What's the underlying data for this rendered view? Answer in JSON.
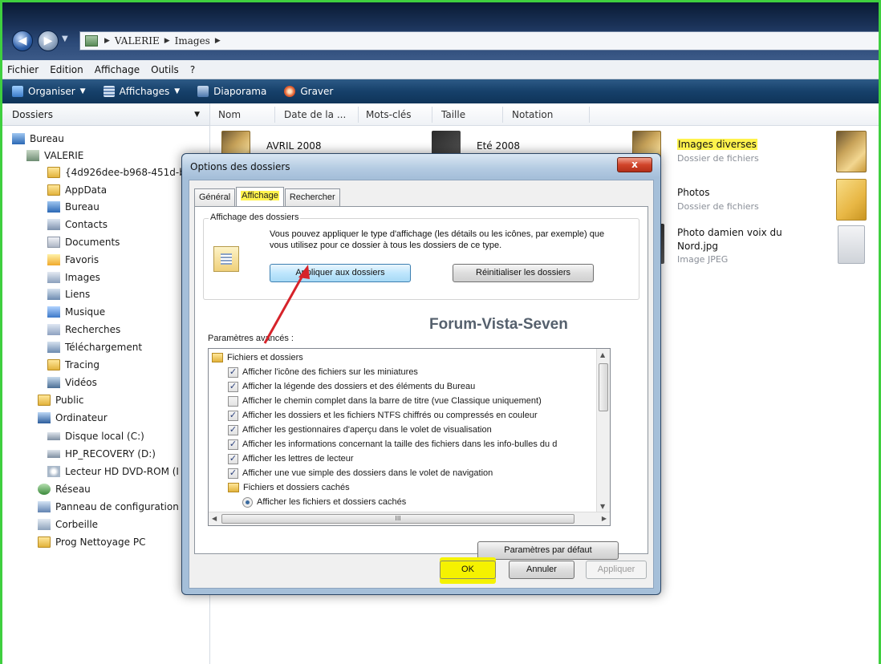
{
  "breadcrumb": [
    "VALERIE",
    "Images"
  ],
  "menu": [
    "Fichier",
    "Edition",
    "Affichage",
    "Outils",
    "?"
  ],
  "toolbar": {
    "organiser": "Organiser",
    "affichages": "Affichages",
    "diaporama": "Diaporama",
    "graver": "Graver"
  },
  "leftpane": {
    "header": "Dossiers",
    "tree": [
      {
        "label": "Bureau",
        "icon": "desktop-icon"
      },
      {
        "label": "VALERIE",
        "icon": "user-folder-icon"
      },
      {
        "label": "{4d926dee-b968-451d-b",
        "icon": "folder-icon"
      },
      {
        "label": "AppData",
        "icon": "folder-icon"
      },
      {
        "label": "Bureau",
        "icon": "desktop-folder-icon"
      },
      {
        "label": "Contacts",
        "icon": "contacts-icon"
      },
      {
        "label": "Documents",
        "icon": "documents-icon"
      },
      {
        "label": "Favoris",
        "icon": "favorites-icon"
      },
      {
        "label": "Images",
        "icon": "images-icon"
      },
      {
        "label": "Liens",
        "icon": "links-icon"
      },
      {
        "label": "Musique",
        "icon": "music-icon"
      },
      {
        "label": "Recherches",
        "icon": "searches-icon"
      },
      {
        "label": "Téléchargement",
        "icon": "downloads-icon"
      },
      {
        "label": "Tracing",
        "icon": "folder-icon"
      },
      {
        "label": "Vidéos",
        "icon": "videos-icon"
      },
      {
        "label": "Public",
        "icon": "folder-icon"
      },
      {
        "label": "Ordinateur",
        "icon": "computer-icon"
      },
      {
        "label": "Disque local (C:)",
        "icon": "drive-icon"
      },
      {
        "label": "HP_RECOVERY (D:)",
        "icon": "drive-icon"
      },
      {
        "label": "Lecteur HD DVD-ROM (I",
        "icon": "dvd-icon"
      },
      {
        "label": "Réseau",
        "icon": "network-icon"
      },
      {
        "label": "Panneau de configuration",
        "icon": "control-panel-icon"
      },
      {
        "label": "Corbeille",
        "icon": "trash-icon"
      },
      {
        "label": "Prog Nettoyage PC",
        "icon": "folder-icon"
      }
    ]
  },
  "columns": [
    "Nom",
    "Date de la ...",
    "Mots-clés",
    "Taille",
    "Notation"
  ],
  "files": [
    {
      "name": "AVRIL 2008",
      "type": ""
    },
    {
      "name": "Eté 2008",
      "type": ""
    },
    {
      "name": "Images diverses",
      "type": "Dossier de fichiers"
    },
    {
      "name": "Photos",
      "type": "Dossier de fichiers"
    },
    {
      "name": "Photo damien voix du",
      "name2": "Nord.jpg",
      "type": "Image JPEG"
    }
  ],
  "dialog": {
    "title": "Options des dossiers",
    "close": "x",
    "tabs": [
      "Général",
      "Affichage",
      "Rechercher"
    ],
    "group_title": "Affichage des dossiers",
    "group_desc": "Vous pouvez appliquer le type d'affichage (les détails ou les icônes, par exemple) que vous utilisez pour ce dossier à tous les dossiers de ce type.",
    "apply_folders": "Appliquer aux dossiers",
    "reset_folders": "Réinitialiser les dossiers",
    "watermark": "Forum-Vista-Seven",
    "advanced_label": "Paramètres avancés :",
    "advanced": [
      {
        "kind": "folder",
        "label": "Fichiers et dossiers"
      },
      {
        "kind": "check",
        "checked": true,
        "label": "Afficher l'icône des fichiers sur les miniatures"
      },
      {
        "kind": "check",
        "checked": true,
        "label": "Afficher la légende des dossiers et des éléments du Bureau"
      },
      {
        "kind": "check",
        "checked": false,
        "label": "Afficher le chemin complet dans la barre de titre (vue Classique uniquement)"
      },
      {
        "kind": "check",
        "checked": true,
        "label": "Afficher les dossiers et les fichiers NTFS chiffrés ou compressés en couleur"
      },
      {
        "kind": "check",
        "checked": true,
        "label": "Afficher les gestionnaires d'aperçu dans le volet de visualisation"
      },
      {
        "kind": "check",
        "checked": true,
        "label": "Afficher les informations concernant la taille des fichiers dans les info-bulles du d"
      },
      {
        "kind": "check",
        "checked": true,
        "label": "Afficher les lettres de lecteur"
      },
      {
        "kind": "check",
        "checked": true,
        "label": "Afficher une vue simple des dossiers dans le volet de navigation"
      },
      {
        "kind": "folder",
        "label": "Fichiers et dossiers cachés"
      },
      {
        "kind": "radio",
        "label": "Afficher les fichiers et dossiers cachés"
      }
    ],
    "hscroll_grip": "III",
    "defaults": "Paramètres par défaut",
    "ok": "OK",
    "cancel": "Annuler",
    "apply": "Appliquer"
  },
  "colors": {
    "highlight": "#fff34d",
    "arrow": "#d6232a",
    "frame": "#3fcf3f"
  }
}
